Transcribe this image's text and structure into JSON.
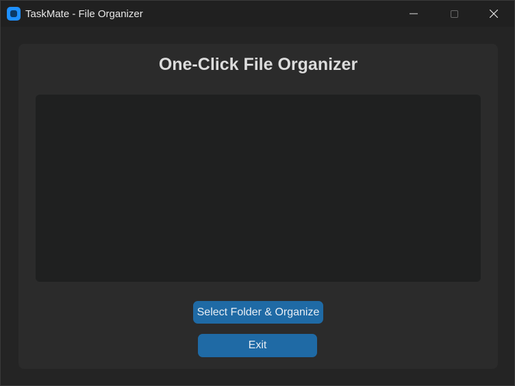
{
  "window": {
    "title": "TaskMate - File Organizer",
    "app_icon": "taskmate-app-icon",
    "controls": {
      "minimize_icon": "minimize-icon",
      "maximize_icon": "maximize-icon",
      "close_icon": "close-icon"
    }
  },
  "main": {
    "heading": "One-Click File Organizer",
    "log_text": "",
    "buttons": {
      "organize_label": "Select Folder & Organize",
      "exit_label": "Exit"
    }
  },
  "colors": {
    "accent": "#1f6aa5",
    "app_icon": "#1e90ff",
    "panel": "#2b2b2b",
    "textbox": "#1f2020",
    "background": "#242424"
  }
}
